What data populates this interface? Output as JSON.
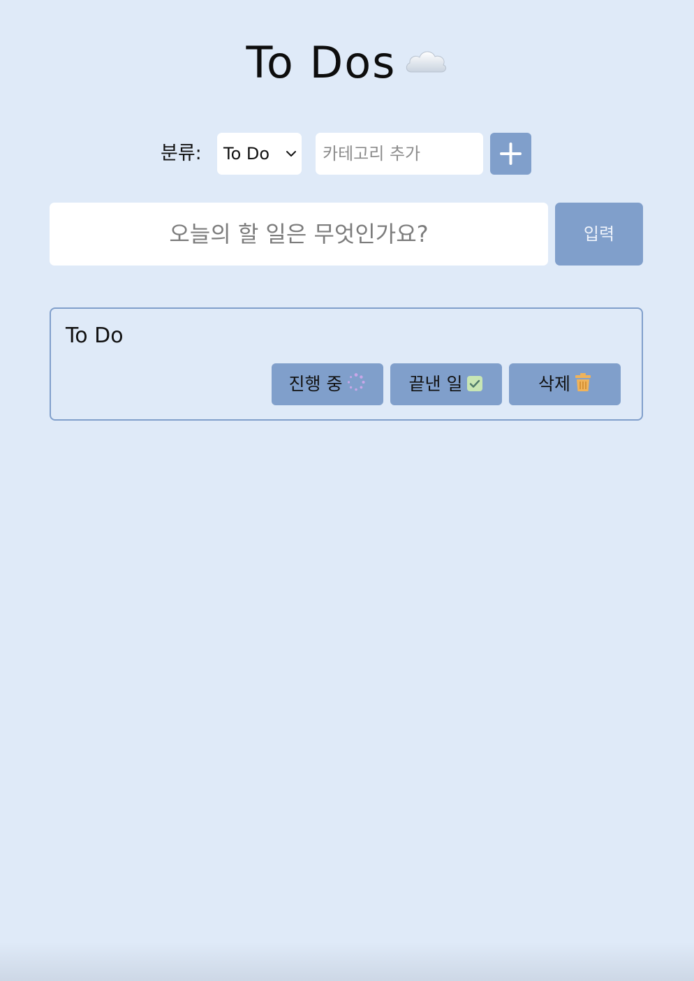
{
  "header": {
    "title": "To Dos",
    "title_icon": "cloud-icon"
  },
  "category_bar": {
    "label": "분류:",
    "selected_category": "To Do",
    "new_category_placeholder": "카테고리 추가",
    "new_category_value": "",
    "add_button_icon": "plus-icon"
  },
  "todo_form": {
    "placeholder": "오늘의 할 일은 무엇인가요?",
    "value": "",
    "submit_label": "입력"
  },
  "todos": [
    {
      "text": "To Do",
      "actions": [
        {
          "label": "진행 중",
          "icon": "spinner-icon"
        },
        {
          "label": "끝낸 일",
          "icon": "check-box-icon"
        },
        {
          "label": "삭제",
          "icon": "trash-icon"
        }
      ]
    }
  ],
  "colors": {
    "background": "#dfeaf8",
    "accent": "#809fcb",
    "spinner": "#c9a6e8",
    "check": "#c8e6b4",
    "trash": "#f0b35a"
  }
}
